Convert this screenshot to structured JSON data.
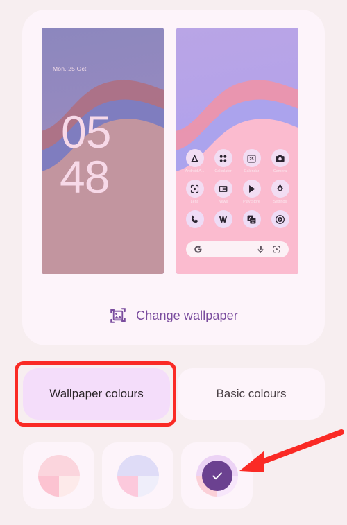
{
  "screen": {
    "app": "wallpaper-and-style",
    "background_color": "#F7EEF0",
    "card_color": "#FDF4FA"
  },
  "preview": {
    "lock_screen": {
      "date": "Mon, 25 Oct",
      "hour": "05",
      "minute": "48"
    },
    "home_screen": {
      "app_rows": [
        [
          {
            "label": "Android A...",
            "icon": "android-auto-icon"
          },
          {
            "label": "Calculator",
            "icon": "calculator-icon"
          },
          {
            "label": "Calendar",
            "icon": "calendar-25-icon"
          },
          {
            "label": "Camera",
            "icon": "camera-icon"
          }
        ],
        [
          {
            "label": "Lens",
            "icon": "lens-icon"
          },
          {
            "label": "News",
            "icon": "news-icon"
          },
          {
            "label": "Play Store",
            "icon": "play-store-icon"
          },
          {
            "label": "Settings",
            "icon": "gear-icon"
          }
        ]
      ],
      "dock": [
        {
          "label": "Phone",
          "icon": "phone-icon"
        },
        {
          "label": "Wallet",
          "icon": "wallet-w-icon"
        },
        {
          "label": "Translate",
          "icon": "translate-icon"
        },
        {
          "label": "YT Music",
          "icon": "youtube-music-icon"
        }
      ],
      "search_bar": {
        "logo": "google-g-icon",
        "mic": "microphone-icon",
        "lens": "google-lens-icon"
      }
    }
  },
  "change_wallpaper": {
    "label": "Change wallpaper",
    "icon": "image-photo-icon",
    "color": "#7A4C9E"
  },
  "tabs": [
    {
      "label": "Wallpaper colours",
      "selected": true
    },
    {
      "label": "Basic colours",
      "selected": false
    }
  ],
  "swatches": [
    {
      "name": "swatch-pink",
      "selected": false,
      "quadrants": {
        "top": "#FBD5DD",
        "bottom_left": "#FCC3D1",
        "bottom_right": "#FDEAEA"
      }
    },
    {
      "name": "swatch-lavender",
      "selected": false,
      "quadrants": {
        "top": "#DFDCF7",
        "bottom_left": "#FCC9DC",
        "bottom_right": "#EFEEFA"
      }
    },
    {
      "name": "swatch-purple",
      "selected": true,
      "quadrants": {
        "top": "#ECD3F5",
        "bottom_left": "#FBD0D8",
        "bottom_right": "#F7E6FB"
      },
      "selected_color": "#6B4190",
      "check_icon": "check-icon"
    }
  ],
  "annotations": {
    "highlight_color": "#FA2A25",
    "highlight_target": "Wallpaper colours",
    "arrow_color": "#FA2A25",
    "arrow_target": "swatch-purple"
  }
}
